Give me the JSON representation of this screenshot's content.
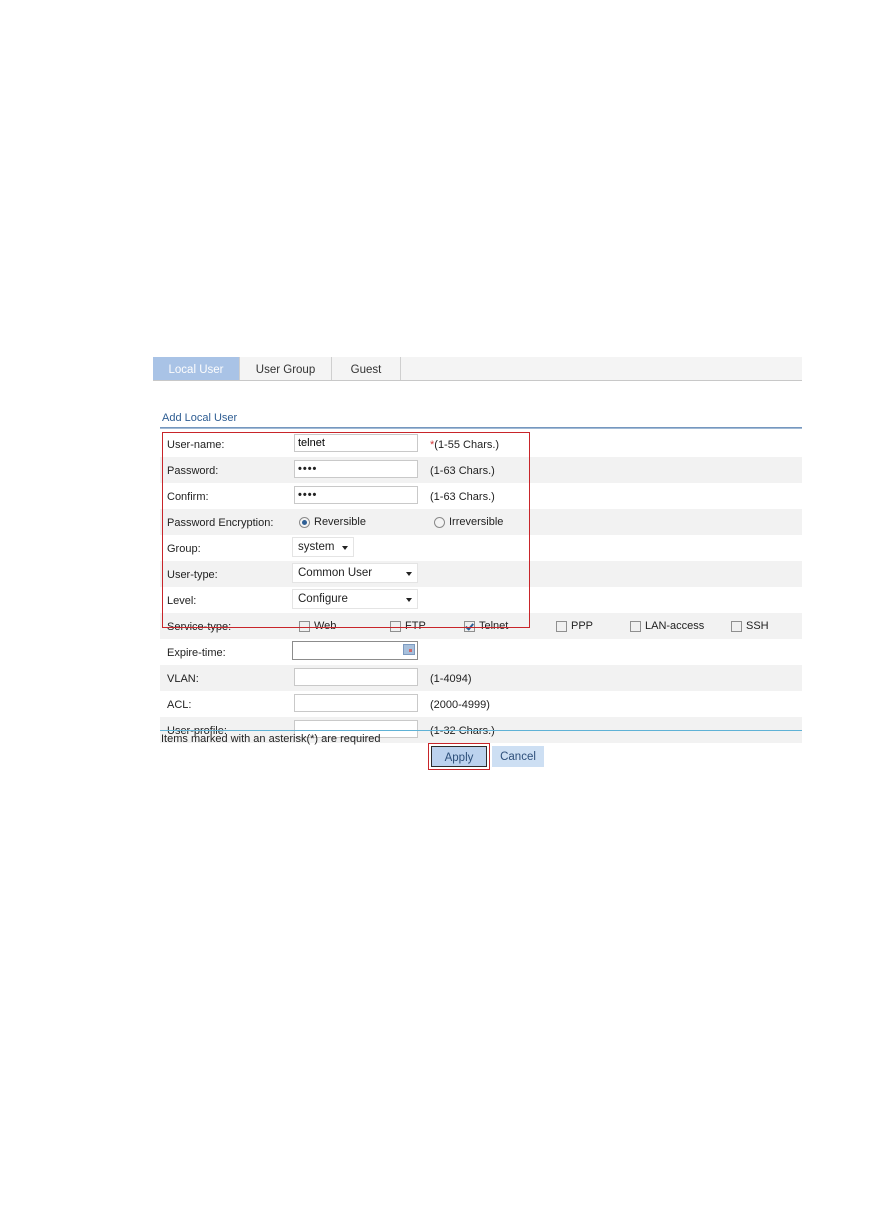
{
  "tabs": [
    {
      "label": "Local User",
      "active": true
    },
    {
      "label": "User Group",
      "active": false
    },
    {
      "label": "Guest",
      "active": false
    }
  ],
  "section_title": "Add Local User",
  "form": {
    "username": {
      "label": "User-name:",
      "value": "telnet",
      "required_mark": "*",
      "hint": "(1-55 Chars.)"
    },
    "password": {
      "label": "Password:",
      "value": "••••",
      "hint": "(1-63 Chars.)"
    },
    "confirm": {
      "label": "Confirm:",
      "value": "••••",
      "hint": "(1-63 Chars.)"
    },
    "encryption": {
      "label": "Password Encryption:",
      "options": [
        {
          "label": "Reversible",
          "selected": true
        },
        {
          "label": "Irreversible",
          "selected": false
        }
      ]
    },
    "group": {
      "label": "Group:",
      "value": "system"
    },
    "user_type": {
      "label": "User-type:",
      "value": "Common User"
    },
    "level": {
      "label": "Level:",
      "value": "Configure"
    },
    "service_type": {
      "label": "Service-type:",
      "options": [
        {
          "label": "Web",
          "checked": false
        },
        {
          "label": "FTP",
          "checked": false
        },
        {
          "label": "Telnet",
          "checked": true
        },
        {
          "label": "PPP",
          "checked": false
        },
        {
          "label": "LAN-access",
          "checked": false
        },
        {
          "label": "SSH",
          "checked": false
        }
      ]
    },
    "expire_time": {
      "label": "Expire-time:",
      "value": "",
      "icon": "calendar-icon"
    },
    "vlan": {
      "label": "VLAN:",
      "value": "",
      "hint": "(1-4094)"
    },
    "acl": {
      "label": "ACL:",
      "value": "",
      "hint": "(2000-4999)"
    },
    "user_profile": {
      "label": "User-profile:",
      "value": "",
      "hint": "(1-32 Chars.)"
    }
  },
  "required_note": "Items marked with an asterisk(*) are required",
  "buttons": {
    "apply": "Apply",
    "cancel": "Cancel"
  },
  "colors": {
    "highlight": "#c8252a",
    "active_tab": "#a9c3e6",
    "title": "#2d5c92"
  }
}
